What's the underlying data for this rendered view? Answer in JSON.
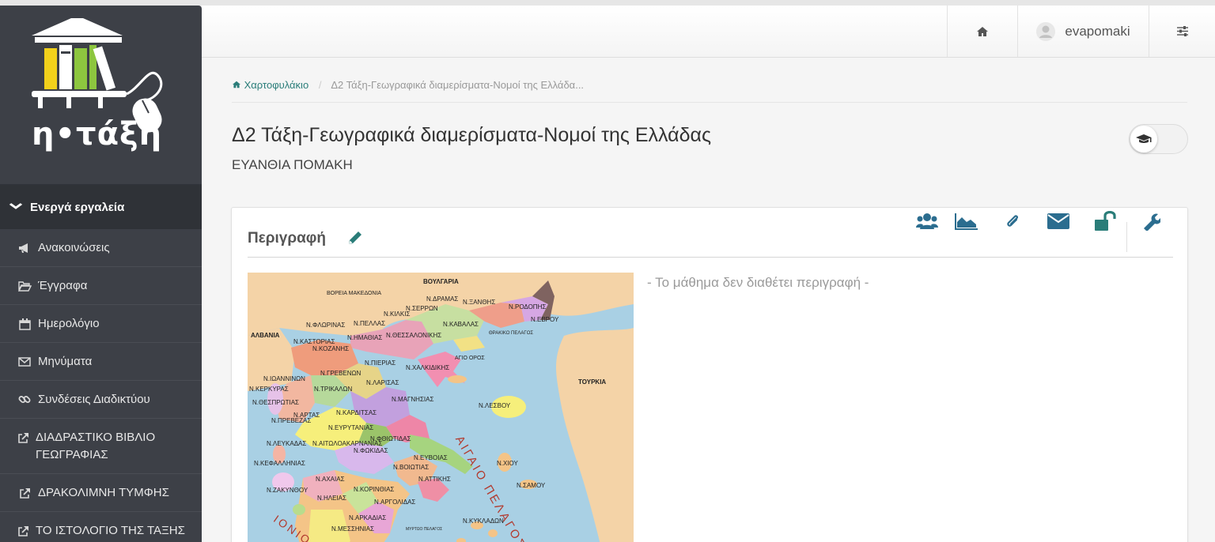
{
  "app": {
    "logo_text": "η•τάξη"
  },
  "sidebar": {
    "section_label": "Ενεργά εργαλεία",
    "items": [
      {
        "label": "Ανακοινώσεις",
        "icon": "bullhorn-icon"
      },
      {
        "label": "Έγγραφα",
        "icon": "folder-open-icon"
      },
      {
        "label": "Ημερολόγιο",
        "icon": "calendar-icon"
      },
      {
        "label": "Μηνύματα",
        "icon": "envelope-icon"
      },
      {
        "label": "Συνδέσεις Διαδικτύου",
        "icon": "link-icon"
      },
      {
        "label": "ΔΙΑΔΡΑΣΤΙΚΟ ΒΙΒΛΙΟ ΓΕΩΓΡΑΦΙΑΣ",
        "icon": "external-link-icon"
      },
      {
        "label": "ΔΡΑΚΟΛΙΜΝΗ ΤΥΜΦΗΣ",
        "icon": "external-link-icon"
      },
      {
        "label": "ΤΟ ΙΣΤΟΛΟΓΙΟ ΤΗΣ ΤΑΞΗΣ ΜΑΣ ΣΤΗΝ e-me",
        "icon": "external-link-icon"
      }
    ]
  },
  "header": {
    "username": "evapomaki",
    "icons": [
      "home-icon",
      "user-avatar-icon",
      "sliders-icon"
    ]
  },
  "breadcrumb": {
    "home": "Χαρτοφυλάκιο",
    "current": "Δ2 Τάξη-Γεωγραφικά διαμερίσματα-Νομοί της Ελλάδα..."
  },
  "course": {
    "title": "Δ2 Τάξη-Γεωγραφικά διαμερίσματα-Νομοί της Ελλάδας",
    "teacher": "ΕΥΑΝΘΙΑ ΠΟΜΑΚΗ"
  },
  "panel": {
    "title": "Περιγραφή",
    "no_description": "- Το μάθημα δεν διαθέτει περιγραφή -",
    "tool_icons": [
      "users-icon",
      "area-chart-icon",
      "paperclip-icon",
      "envelope-icon",
      "unlock-icon",
      "wrench-icon"
    ]
  },
  "map": {
    "labels": {
      "bulgaria": "ΒΟΥΛΓΑΡΙΑ",
      "north_macedonia": "ΒΟΡΕΙΑ ΜΑΚΕΔΟΝΙΑ",
      "albania": "ΑΛΒΑΝΙΑ",
      "turkey": "ΤΟΥΡΚΙΑ",
      "thracian_sea": "ΘΡΑΚΙΚΟ ΠΕΛΑΓΟΣ",
      "aegean": "ΑΙΓΑΙΟ ΠΕΛΑΓΟΣ",
      "ionian": "ΙΟΝΙΟ",
      "agio_oros": "ΑΓΙΟ ΟΡΟΣ",
      "myrtoo": "ΜΥΡΤΩΟ ΠΕΛΑΓΟΣ"
    },
    "prefectures": [
      "Ν.ΔΡΑΜΑΣ",
      "Ν.ΞΑΝΘΗΣ",
      "Ν.ΡΟΔΟΠΗΣ",
      "Ν.ΣΕΡΡΩΝ",
      "Ν.ΕΒΡΟΥ",
      "Ν.ΚΙΛΚΙΣ",
      "Ν.ΚΑΒΑΛΑΣ",
      "Ν.ΦΛΩΡΙΝΑΣ",
      "Ν.ΠΕΛΛΑΣ",
      "Ν.ΚΑΣΤΟΡΙΑΣ",
      "Ν.ΗΜΑΘΙΑΣ",
      "Ν.ΘΕΣΣΑΛΟΝΙΚΗΣ",
      "Ν.ΚΟΖΑΝΗΣ",
      "Ν.ΧΑΛΚΙΔΙΚΗΣ",
      "Ν.ΓΡΕΒΕΝΩΝ",
      "Ν.ΠΙΕΡΙΑΣ",
      "Ν.ΙΩΑΝΝΙΝΩΝ",
      "Ν.ΛΑΡΙΣΑΣ",
      "Ν.ΚΕΡΚΥΡΑΣ",
      "Ν.ΤΡΙΚΑΛΩΝ",
      "Ν.ΘΕΣΠΡΩΤΙΑΣ",
      "Ν.ΜΑΓΝΗΣΙΑΣ",
      "Ν.ΛΕΣΒΟΥ",
      "Ν.ΑΡΤΑΣ",
      "Ν.ΚΑΡΔΙΤΣΑΣ",
      "Ν.ΠΡΕΒΕΖΑΣ",
      "Ν.ΕΥΡΥΤΑΝΙΑΣ",
      "Ν.ΦΘΙΩΤΙΔΑΣ",
      "Ν.ΛΕΥΚΑΔΑΣ",
      "Ν.ΑΙΤΩΛΟΑΚΑΡΝΑΝΙΑΣ",
      "Ν.ΦΩΚΙΔΑΣ",
      "Ν.ΕΥΒΟΙΑΣ",
      "Ν.ΧΙΟΥ",
      "Ν.ΚΕΦΑΛΛΗΝΙΑΣ",
      "Ν.ΒΟΙΩΤΙΑΣ",
      "Ν.ΑΤΤΙΚΗΣ",
      "Ν.ΑΧΑΙΑΣ",
      "Ν.ΣΑΜΟΥ",
      "Ν.ΖΑΚΥΝΘΟΥ",
      "Ν.ΚΟΡΙΝΘΙΑΣ",
      "Ν.ΗΛΕΙΑΣ",
      "Ν.ΑΡΓΟΛΙΔΑΣ",
      "Ν.ΑΡΚΑΔΙΑΣ",
      "Ν.ΚΥΚΛΑΔΩΝ",
      "Ν.ΜΕΣΣΗΝΙΑΣ"
    ]
  },
  "colors": {
    "sidebar_bg": "#3d4047",
    "accent_teal": "#2a7d79",
    "tool_icon": "#2b6d8f"
  }
}
